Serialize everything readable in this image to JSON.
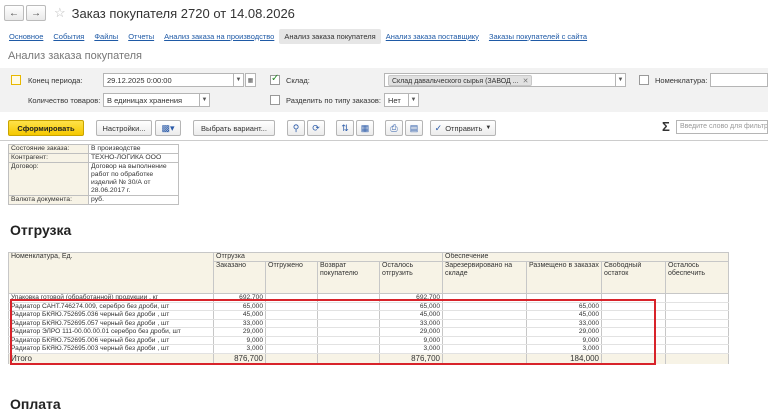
{
  "header": {
    "back_icon": "arrow-left-icon",
    "forward_icon": "arrow-right-icon",
    "star_icon": "star-icon",
    "title": "Заказ покупателя 2720 от 14.08.2026"
  },
  "tabs": [
    {
      "label": "Основное",
      "active": false
    },
    {
      "label": "События",
      "active": false
    },
    {
      "label": "Файлы",
      "active": false
    },
    {
      "label": "Отчеты",
      "active": false
    },
    {
      "label": "Анализ заказа на производство",
      "active": false
    },
    {
      "label": "Анализ заказа покупателя",
      "active": true
    },
    {
      "label": "Анализ заказа поставщику",
      "active": false
    },
    {
      "label": "Заказы покупателей с сайта",
      "active": false
    }
  ],
  "form_title": "Анализ заказа покупателя",
  "params": {
    "period_end_label": "Конец периода:",
    "period_end_value": "29.12.2025  0:00:00",
    "warehouse_label": "Склад:",
    "warehouse_value": "Склад давальческого сырья (ЗАВОД ...",
    "nomenclature_label": "Номенклатура:",
    "qty_label": "Количество товаров:",
    "qty_value": "В единицах хранения",
    "split_label": "Разделить по типу заказов:",
    "split_value": "Нет"
  },
  "toolbar": {
    "generate": "Сформировать",
    "settings": "Настройки...",
    "choose_variant": "Выбрать вариант...",
    "send": "Отправить",
    "search_placeholder": "Введите слово для фильтра"
  },
  "info": [
    {
      "key": "Состояние заказа:",
      "value": "В производстве"
    },
    {
      "key": "Контрагент:",
      "value": "ТЕХНО-ЛОГИКА ООО"
    },
    {
      "key": "Договор:",
      "value": "Договор на выполнение работ по обработке изделий № 30/А от 28.06.2017 г."
    },
    {
      "key": "Валюта документа:",
      "value": "руб."
    }
  ],
  "section_shipment": "Отгрузка",
  "section_payment": "Оплата",
  "grid": {
    "col_nomenclature": "Номенклатура, Ед.",
    "group_shipment": "Отгрузка",
    "group_provision": "Обеспечение",
    "cols": [
      "Заказано",
      "Отгружено",
      "Возврат покупателю",
      "Осталось отгрузить",
      "Зарезервировано на складе",
      "Размещено в заказах",
      "Свободный остаток",
      "Осталось обеспечить"
    ],
    "rows": [
      {
        "name": "Упаковка готовой (обработанной) продукции  , кг",
        "ordered": "692,700",
        "shipped": "",
        "returned": "",
        "remaining": "692,700",
        "reserved": "",
        "placed": "",
        "free": "",
        "to_provide": ""
      },
      {
        "name": "Радиатор САНТ.746274.009, серебро без дроби, шт",
        "ordered": "65,000",
        "shipped": "",
        "returned": "",
        "remaining": "65,000",
        "reserved": "",
        "placed": "65,000",
        "free": "",
        "to_provide": ""
      },
      {
        "name": "Радиатор БКЯЮ.752695.036 черный без дроби  , шт",
        "ordered": "45,000",
        "shipped": "",
        "returned": "",
        "remaining": "45,000",
        "reserved": "",
        "placed": "45,000",
        "free": "",
        "to_provide": ""
      },
      {
        "name": "Радиатор БКЯЮ.752695.057 черный без дроби  , шт",
        "ordered": "33,000",
        "shipped": "",
        "returned": "",
        "remaining": "33,000",
        "reserved": "",
        "placed": "33,000",
        "free": "",
        "to_provide": ""
      },
      {
        "name": "Радиатор ЭЛРО 111-00.00.00.01 серебро без дроби, шт",
        "ordered": "29,000",
        "shipped": "",
        "returned": "",
        "remaining": "29,000",
        "reserved": "",
        "placed": "29,000",
        "free": "",
        "to_provide": ""
      },
      {
        "name": "Радиатор БКЯЮ.752695.006 черный без дроби  , шт",
        "ordered": "9,000",
        "shipped": "",
        "returned": "",
        "remaining": "9,000",
        "reserved": "",
        "placed": "9,000",
        "free": "",
        "to_provide": ""
      },
      {
        "name": "Радиатор БКЯЮ.752695.003 черный без дроби  , шт",
        "ordered": "3,000",
        "shipped": "",
        "returned": "",
        "remaining": "3,000",
        "reserved": "",
        "placed": "3,000",
        "free": "",
        "to_provide": ""
      }
    ],
    "total": {
      "label": "Итого",
      "ordered": "876,700",
      "remaining": "876,700",
      "placed": "184,000"
    }
  }
}
